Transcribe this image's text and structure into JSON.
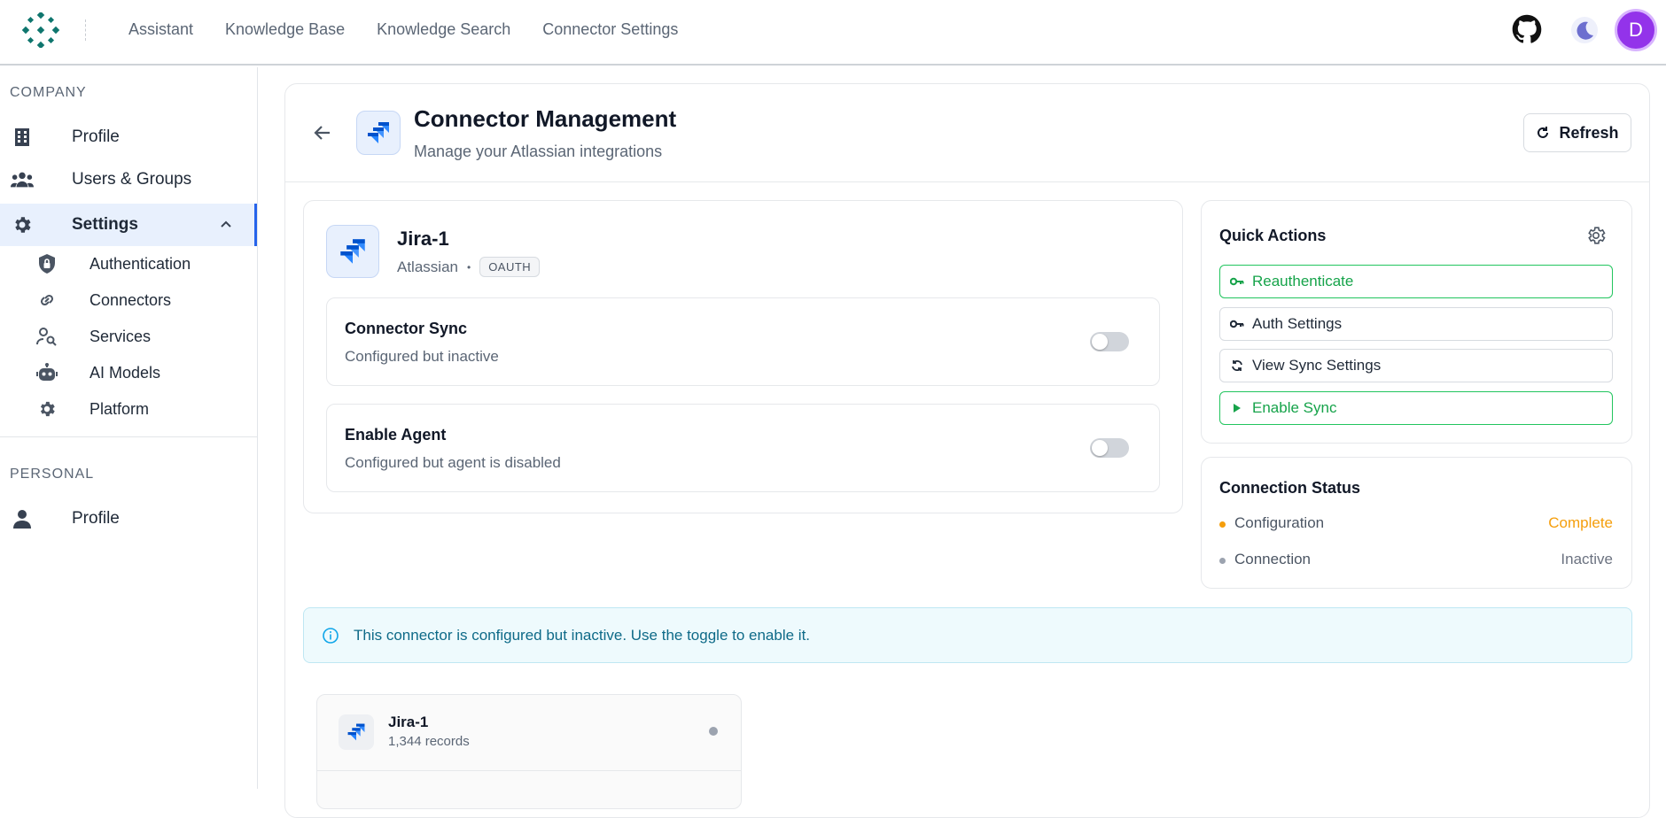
{
  "topnav": {
    "items": [
      "Assistant",
      "Knowledge Base",
      "Knowledge Search",
      "Connector Settings"
    ]
  },
  "user": {
    "avatar_letter": "D",
    "avatar_color": "#9333ea"
  },
  "sidebar": {
    "company_label": "COMPANY",
    "personal_label": "PERSONAL",
    "items": {
      "profile": "Profile",
      "users_groups": "Users & Groups",
      "settings": "Settings",
      "authentication": "Authentication",
      "connectors": "Connectors",
      "services": "Services",
      "ai_models": "AI Models",
      "platform": "Platform",
      "personal_profile": "Profile"
    }
  },
  "header": {
    "title": "Connector Management",
    "subtitle": "Manage your Atlassian integrations",
    "refresh_label": "Refresh"
  },
  "connector": {
    "name": "Jira-1",
    "vendor": "Atlassian",
    "separator": "•",
    "auth_badge": "OAUTH",
    "sync": {
      "title": "Connector Sync",
      "status": "Configured but inactive",
      "enabled": false
    },
    "agent": {
      "title": "Enable Agent",
      "status": "Configured but agent is disabled",
      "enabled": false
    }
  },
  "quick_actions": {
    "title": "Quick Actions",
    "buttons": {
      "reauthenticate": "Reauthenticate",
      "auth_settings": "Auth Settings",
      "view_sync_settings": "View Sync Settings",
      "enable_sync": "Enable Sync"
    }
  },
  "connection_status": {
    "title": "Connection Status",
    "configuration": {
      "label": "Configuration",
      "value": "Complete",
      "color": "#f59e0b"
    },
    "connection": {
      "label": "Connection",
      "value": "Inactive",
      "color": "#9ca3af"
    }
  },
  "info_message": "This connector is configured but inactive. Use the toggle to enable it.",
  "record_card": {
    "name": "Jira-1",
    "records": "1,344 records"
  },
  "colors": {
    "accent": "#2563eb",
    "success": "#16a34a",
    "warning": "#f59e0b",
    "info": "#0e6a88"
  }
}
